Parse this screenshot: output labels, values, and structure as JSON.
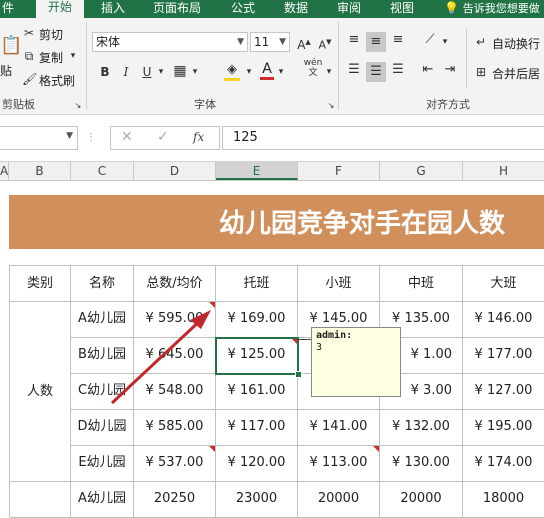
{
  "tabs": [
    {
      "label": "件",
      "active": false
    },
    {
      "label": "开始",
      "active": true
    },
    {
      "label": "插入",
      "active": false
    },
    {
      "label": "页面布局",
      "active": false
    },
    {
      "label": "公式",
      "active": false
    },
    {
      "label": "数据",
      "active": false
    },
    {
      "label": "审阅",
      "active": false
    },
    {
      "label": "视图",
      "active": false
    }
  ],
  "tell_me": "告诉我您想要做",
  "ribbon": {
    "clipboard": {
      "paste_label": "贴",
      "cut_label": "剪切",
      "copy_label": "复制",
      "format_painter_label": "格式刷",
      "group_label": "剪贴板"
    },
    "font": {
      "font_name": "宋体",
      "font_size": "11",
      "bold": "B",
      "italic": "I",
      "underline": "U",
      "phonetic": "wén",
      "group_label": "字体"
    },
    "alignment": {
      "wrap_label": "自动换行",
      "merge_label": "合并后居",
      "group_label": "对齐方式"
    }
  },
  "formula_bar": {
    "name_box": "",
    "fx": "fx",
    "value": "125"
  },
  "column_headers": [
    "A",
    "B",
    "C",
    "D",
    "E",
    "F",
    "G",
    "H"
  ],
  "selected_column": "E",
  "sheet": {
    "title": "幼儿园竞争对手在园人数",
    "headers": [
      "类别",
      "名称",
      "总数/均价",
      "托班",
      "小班",
      "中班",
      "大班"
    ],
    "category_label": "人数",
    "rows": [
      [
        "A幼儿园",
        "¥  595.00",
        "¥  169.00",
        "¥  145.00",
        "¥  135.00",
        "¥  146.00"
      ],
      [
        "B幼儿园",
        "¥  645.00",
        "¥  125.00",
        "",
        "¥  1.00",
        "¥  177.00"
      ],
      [
        "C幼儿园",
        "¥  548.00",
        "¥  161.00",
        "",
        "¥  3.00",
        "¥  127.00"
      ],
      [
        "D幼儿园",
        "¥  585.00",
        "¥  117.00",
        "¥  141.00",
        "¥  132.00",
        "¥  195.00"
      ],
      [
        "E幼儿园",
        "¥  537.00",
        "¥  120.00",
        "¥  113.00",
        "¥  130.00",
        "¥  174.00"
      ],
      [
        "A幼儿园",
        "20250",
        "23000",
        "20000",
        "20000",
        "18000"
      ]
    ]
  },
  "comment": {
    "author": "admin:",
    "text": "3"
  },
  "colors": {
    "excel_green": "#217346",
    "banner": "#d18f5c",
    "note_bg": "#ffffe1",
    "arrow": "#c0282c"
  }
}
